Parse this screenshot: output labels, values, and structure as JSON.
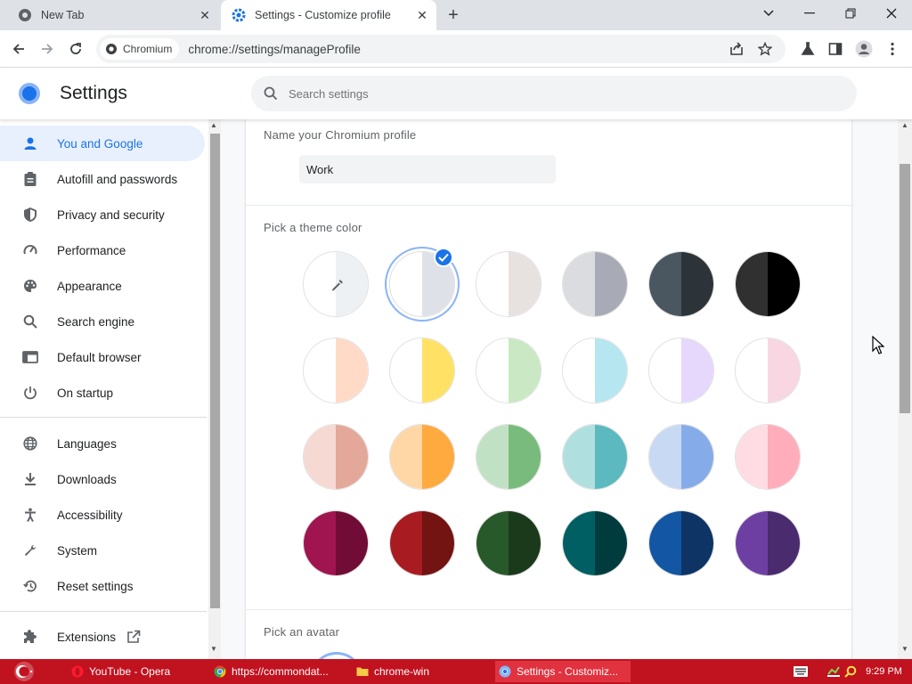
{
  "browser": {
    "tabs": [
      {
        "label": "New Tab",
        "icon": "chromium-icon",
        "active": false
      },
      {
        "label": "Settings - Customize profile",
        "icon": "gear-icon",
        "active": true
      }
    ],
    "chip_label": "Chromium",
    "url": "chrome://settings/manageProfile"
  },
  "settings": {
    "title": "Settings",
    "search_placeholder": "Search settings"
  },
  "sidebar": {
    "items": [
      {
        "label": "You and Google",
        "icon": "person-icon",
        "selected": true
      },
      {
        "label": "Autofill and passwords",
        "icon": "clipboard-icon"
      },
      {
        "label": "Privacy and security",
        "icon": "shield-icon"
      },
      {
        "label": "Performance",
        "icon": "gauge-icon"
      },
      {
        "label": "Appearance",
        "icon": "palette-icon"
      },
      {
        "label": "Search engine",
        "icon": "search-icon"
      },
      {
        "label": "Default browser",
        "icon": "browser-window-icon"
      },
      {
        "label": "On startup",
        "icon": "power-icon"
      },
      {
        "label": "Languages",
        "icon": "globe-icon"
      },
      {
        "label": "Downloads",
        "icon": "download-icon"
      },
      {
        "label": "Accessibility",
        "icon": "accessibility-icon"
      },
      {
        "label": "System",
        "icon": "wrench-icon"
      },
      {
        "label": "Reset settings",
        "icon": "history-icon"
      },
      {
        "label": "Extensions",
        "icon": "puzzle-icon"
      }
    ]
  },
  "profile": {
    "name_label": "Name your Chromium profile",
    "name_value": "Work",
    "theme_label": "Pick a theme color",
    "avatar_label": "Pick an avatar",
    "selected_theme_index": 1,
    "theme_colors": [
      [
        "#ffffff",
        "#eef1f4"
      ],
      [
        "#ffffff",
        "#dee1e8"
      ],
      [
        "#ffffff",
        "#e7e1df"
      ],
      [
        "#dadce0",
        "#a8abb5"
      ],
      [
        "#4a5660",
        "#2d3439"
      ],
      [
        "#303030",
        "#000000"
      ],
      [
        "#ffffff",
        "#ffdbc7"
      ],
      [
        "#ffffff",
        "#ffe265"
      ],
      [
        "#ffffff",
        "#c9e8c3"
      ],
      [
        "#ffffff",
        "#b6e6f0"
      ],
      [
        "#ffffff",
        "#e6d7fd"
      ],
      [
        "#ffffff",
        "#f8d7e2"
      ],
      [
        "#f6d9d3",
        "#e4a89a"
      ],
      [
        "#ffd7a6",
        "#ffaa3e"
      ],
      [
        "#c1e1c5",
        "#79bb7d"
      ],
      [
        "#b0dfdf",
        "#5bb9bf"
      ],
      [
        "#c8d9f4",
        "#85ace8"
      ],
      [
        "#ffdce3",
        "#ffadbb"
      ],
      [
        "#a0154f",
        "#700c36"
      ],
      [
        "#a81c21",
        "#731312"
      ],
      [
        "#27592a",
        "#1b3a1b"
      ],
      [
        "#005f62",
        "#003b3e"
      ],
      [
        "#1356a3",
        "#0e3466"
      ],
      [
        "#6e3fa3",
        "#4a2b6e"
      ]
    ]
  },
  "taskbar": {
    "items": [
      {
        "label": "YouTube - Opera",
        "icon": "opera-icon"
      },
      {
        "label": "https://commondat...",
        "icon": "chrome-icon"
      },
      {
        "label": "chrome-win",
        "icon": "folder-icon"
      },
      {
        "label": "Settings - Customiz...",
        "icon": "chromium-icon",
        "active": true
      }
    ],
    "clock": "9:29 PM"
  }
}
